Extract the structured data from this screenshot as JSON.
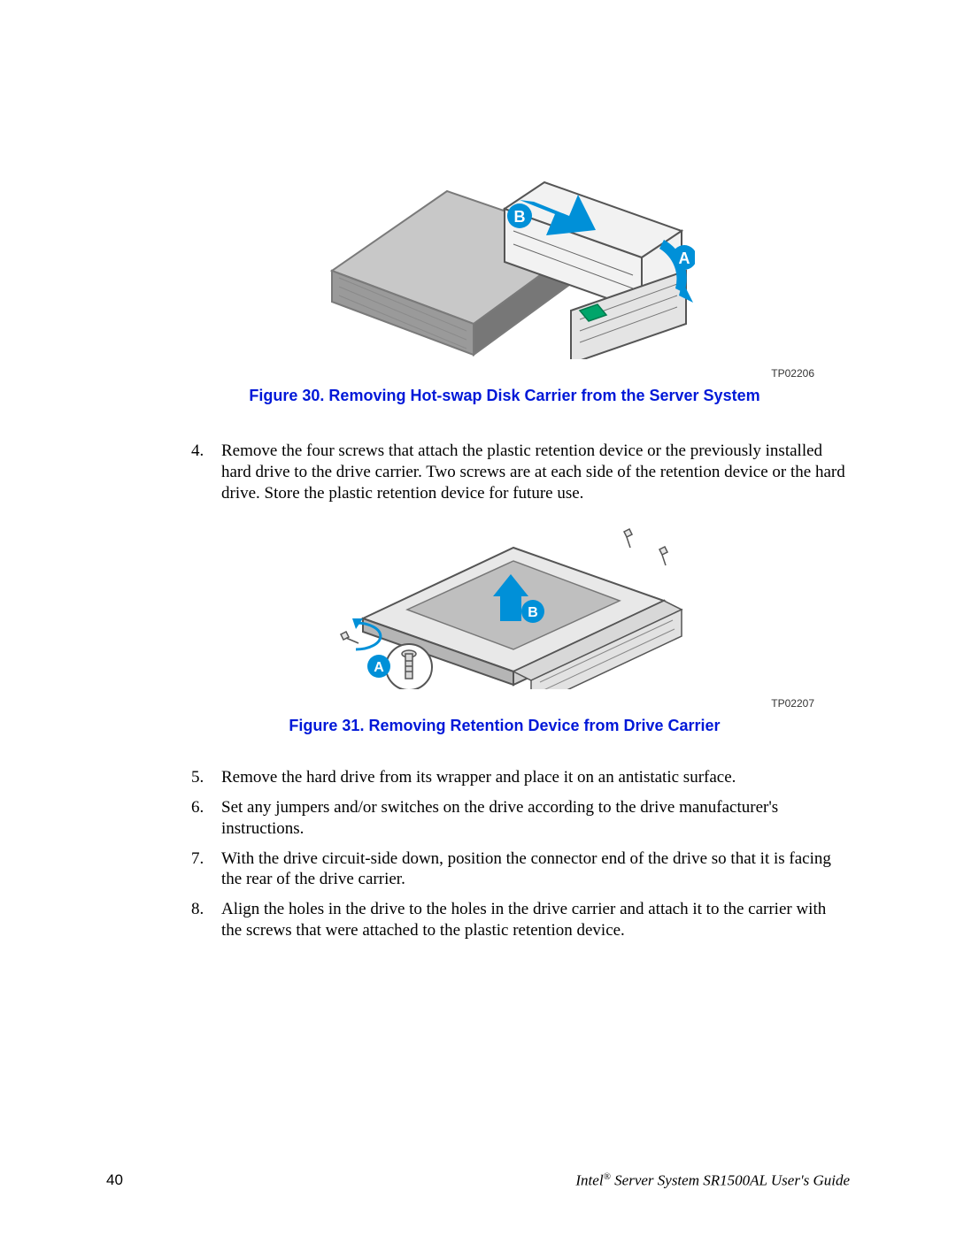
{
  "figure30": {
    "tp_code": "TP02206",
    "caption": "Figure 30. Removing Hot-swap Disk Carrier from the Server System",
    "labels": {
      "a": "A",
      "b": "B"
    }
  },
  "figure31": {
    "tp_code": "TP02207",
    "caption": "Figure 31. Removing Retention Device from Drive Carrier",
    "labels": {
      "a": "A",
      "b": "B"
    }
  },
  "steps_block1": [
    {
      "num": "4.",
      "text": "Remove the four screws that attach the plastic retention device or the previously installed hard drive to the drive carrier. Two screws are at each side of the retention device or the hard drive. Store the plastic retention device for future use."
    }
  ],
  "steps_block2": [
    {
      "num": "5.",
      "text": "Remove the hard drive from its wrapper and place it on an antistatic surface."
    },
    {
      "num": "6.",
      "text": "Set any jumpers and/or switches on the drive according to the drive manufacturer's instructions."
    },
    {
      "num": "7.",
      "text": "With the drive circuit-side down, position the connector end of the drive so that it is facing the rear of the drive carrier."
    },
    {
      "num": "8.",
      "text": "Align the holes in the drive to the holes in the drive carrier and attach it to the carrier with the screws that were attached to the plastic retention device."
    }
  ],
  "footer": {
    "page": "40",
    "doc_prefix": "Intel",
    "doc_suffix": " Server System SR1500AL User's Guide",
    "reg": "®"
  }
}
